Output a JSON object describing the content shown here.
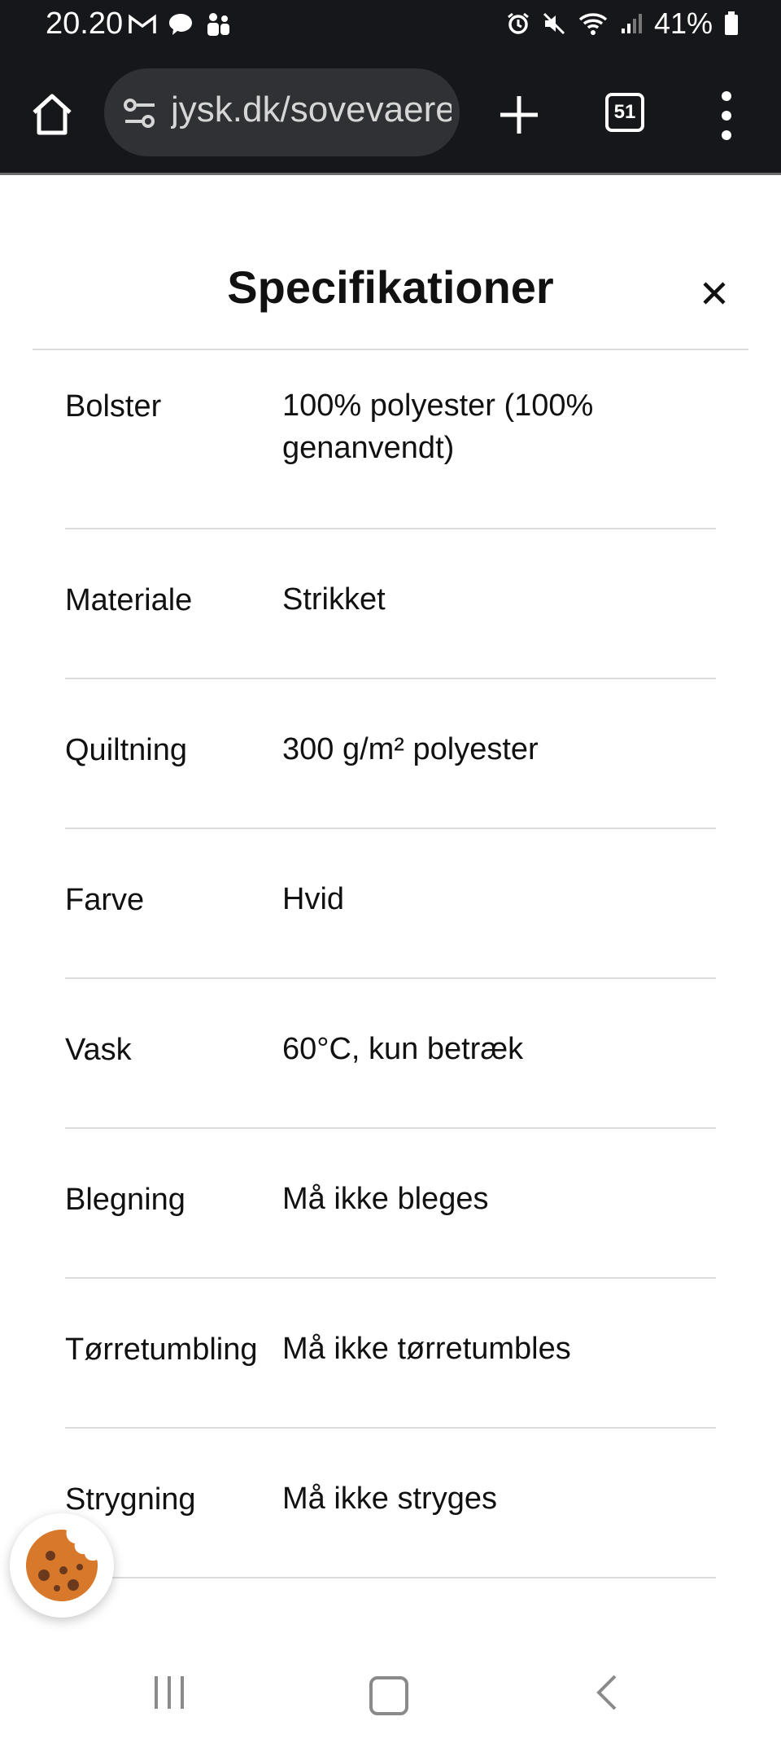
{
  "status_bar": {
    "time": "20.20",
    "battery": "41%",
    "left_icons": [
      "gmail-icon",
      "chat-bubble-icon",
      "teams-icon"
    ],
    "right_icons": [
      "alarm-icon",
      "mute-icon",
      "wifi-icon",
      "signal-icon",
      "battery-icon"
    ]
  },
  "browser": {
    "url": "jysk.dk/sovevaerelse",
    "tab_count": "51"
  },
  "modal": {
    "title": "Specifikationer"
  },
  "specs": [
    {
      "label": "Bolster",
      "value": "100% polyester (100% genanvendt)"
    },
    {
      "label": "Materiale",
      "value": "Strikket"
    },
    {
      "label": "Quiltning",
      "value": "300 g/m² polyester"
    },
    {
      "label": "Farve",
      "value": "Hvid"
    },
    {
      "label": "Vask",
      "value": "60°C, kun betræk"
    },
    {
      "label": "Blegning",
      "value": "Må ikke bleges"
    },
    {
      "label": "Tørretumbling",
      "value": "Må ikke tørretumbles"
    },
    {
      "label": "Strygning",
      "value": "Må ikke stryges"
    }
  ],
  "colors": {
    "chrome_bg": "#16171b",
    "url_bg": "#303134",
    "divider": "#dcdcdc",
    "cookie": "#d8782a"
  }
}
